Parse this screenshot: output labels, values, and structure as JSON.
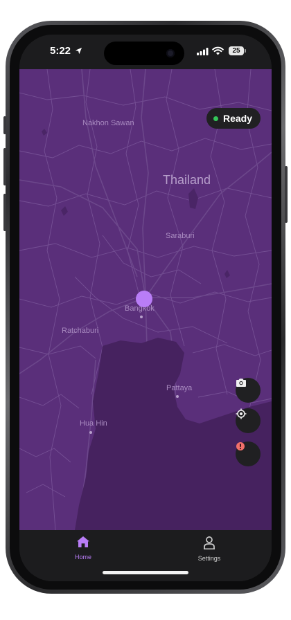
{
  "status_bar": {
    "time": "5:22",
    "battery": "25"
  },
  "map": {
    "country_label": "Thailand",
    "cities": [
      "Nakhon Sawan",
      "Saraburi",
      "Bangkok",
      "Ratchaburi",
      "Pattaya",
      "Hua Hin"
    ]
  },
  "status_pill": {
    "label": "Ready",
    "dot_color": "#34c759"
  },
  "marker_color": "#b97df7",
  "fab": {
    "icons": [
      "camera-icon",
      "locate-icon",
      "alert-icon"
    ]
  },
  "tabs": [
    {
      "label": "Home",
      "icon": "home-icon",
      "active": true,
      "color": "#b97df7"
    },
    {
      "label": "Settings",
      "icon": "person-icon",
      "active": false,
      "color": "#d0d0d0"
    }
  ]
}
